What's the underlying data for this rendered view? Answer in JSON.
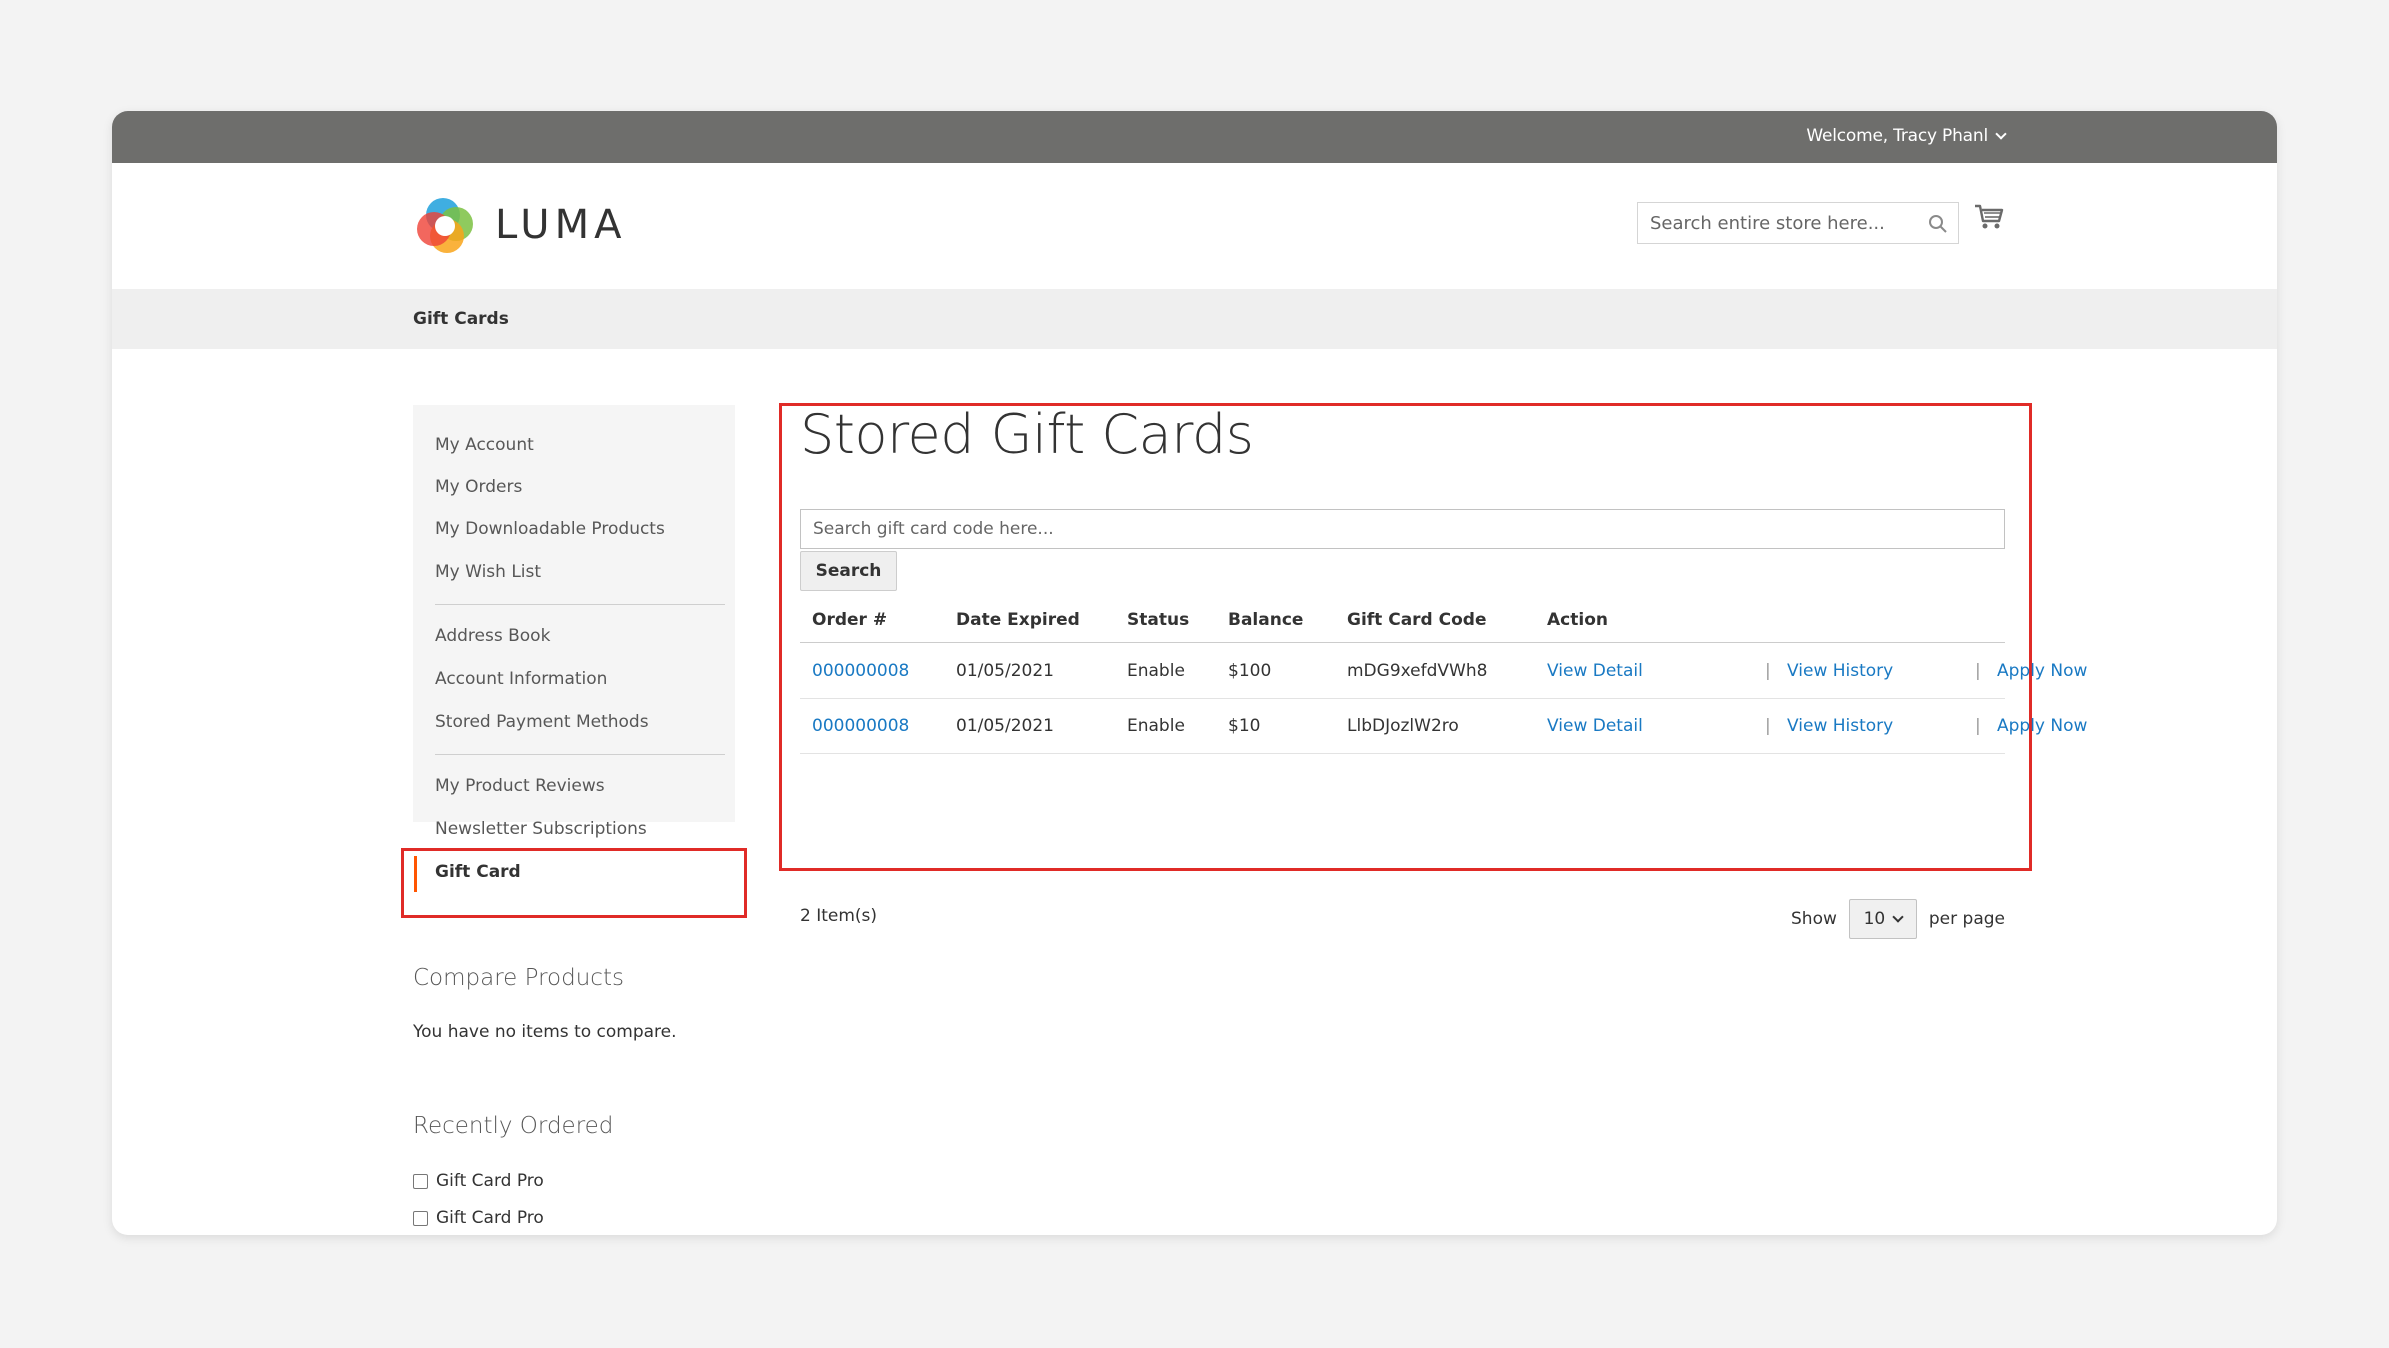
{
  "topbar": {
    "welcome_text": "Welcome, Tracy Phanl"
  },
  "header": {
    "logo_text": "LUMA",
    "search_placeholder": "Search entire store here..."
  },
  "breadcrumb": {
    "current": "Gift Cards"
  },
  "sidebar": {
    "items": [
      {
        "label": "My Account"
      },
      {
        "label": "My Orders"
      },
      {
        "label": "My Downloadable Products"
      },
      {
        "label": "My Wish List"
      },
      {
        "label": "Address Book"
      },
      {
        "label": "Account Information"
      },
      {
        "label": "Stored Payment Methods"
      },
      {
        "label": "My Product Reviews"
      },
      {
        "label": "Newsletter Subscriptions"
      },
      {
        "label": "Gift Card"
      }
    ]
  },
  "compare": {
    "title": "Compare Products",
    "empty_text": "You have no items to compare."
  },
  "recently_ordered": {
    "title": "Recently Ordered",
    "items": [
      {
        "label": "Gift Card Pro"
      },
      {
        "label": "Gift Card Pro"
      }
    ]
  },
  "main": {
    "title": "Stored Gift Cards",
    "search_placeholder": "Search gift card code here...",
    "search_button": "Search",
    "columns": {
      "order": "Order #",
      "date_expired": "Date Expired",
      "status": "Status",
      "balance": "Balance",
      "code": "Gift Card Code",
      "action": "Action"
    },
    "rows": [
      {
        "order": "000000008",
        "date_expired": "01/05/2021",
        "status": "Enable",
        "balance": "$100",
        "code": "mDG9xefdVWh8",
        "view_detail": "View Detail",
        "view_history": "View History",
        "apply_now": "Apply Now"
      },
      {
        "order": "000000008",
        "date_expired": "01/05/2021",
        "status": "Enable",
        "balance": "$10",
        "code": "LlbDJozlW2ro",
        "view_detail": "View Detail",
        "view_history": "View History",
        "apply_now": "Apply Now"
      }
    ],
    "separator": "|",
    "items_count": "2 Item(s)",
    "pager": {
      "show_label": "Show",
      "limit": "10",
      "per_page_label": "per page"
    }
  },
  "colors": {
    "topbar": "#6e6e6c",
    "link": "#1979c3",
    "highlight_box": "#e02b27",
    "active_marker": "#ff5501"
  }
}
